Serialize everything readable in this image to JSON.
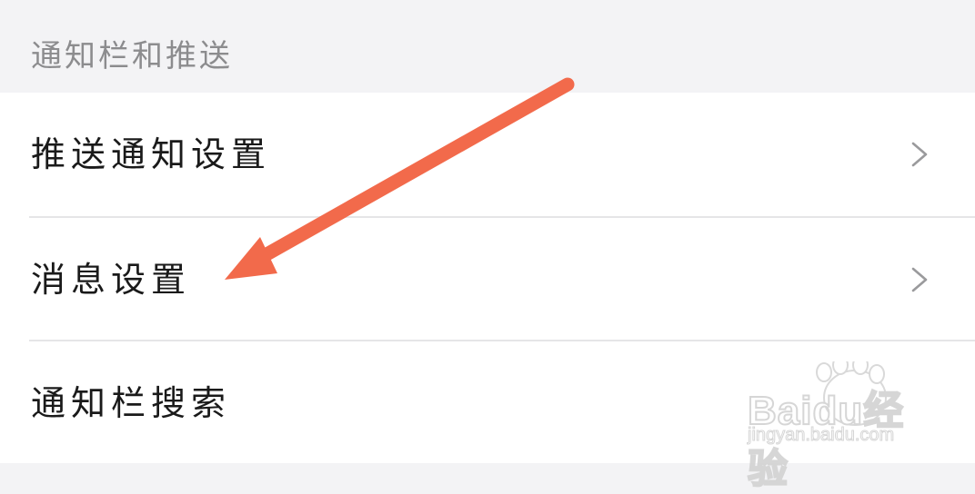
{
  "section": {
    "title": "通知栏和推送"
  },
  "list": {
    "items": [
      {
        "label": "推送通知设置",
        "has_chevron": true
      },
      {
        "label": "消息设置",
        "has_chevron": true
      },
      {
        "label": "通知栏搜索",
        "has_chevron": false
      }
    ]
  },
  "annotation": {
    "arrow_color": "#f26a4b",
    "icon": "arrow-icon"
  },
  "watermark": {
    "brand": "Baidu经验",
    "url": "jingyan.baidu.com",
    "icon": "paw-logo-icon"
  },
  "colors": {
    "header_bg": "#f3f3f5",
    "row_bg": "#ffffff",
    "text": "#1a1a1a",
    "muted_text": "#8c8c8e",
    "divider": "#e5e5e7",
    "chevron": "#9a9a9c"
  }
}
